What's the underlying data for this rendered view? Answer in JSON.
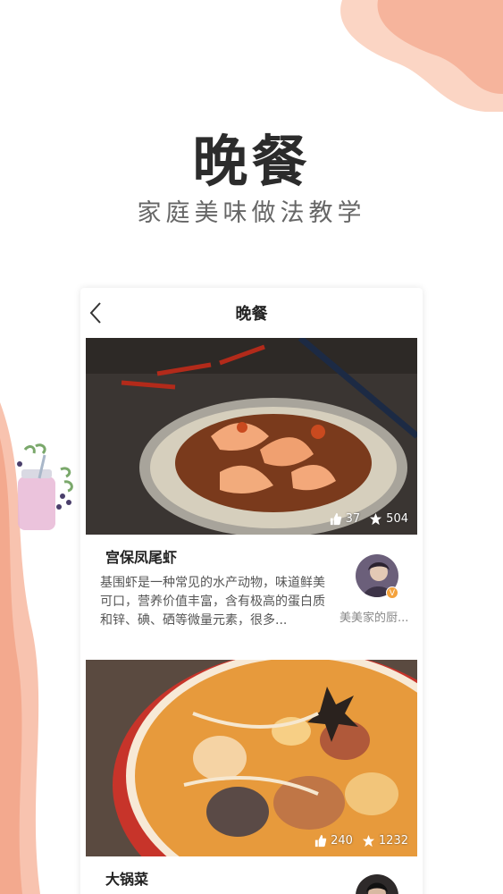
{
  "hero": {
    "title": "晚餐",
    "subtitle": "家庭美味做法教学"
  },
  "nav": {
    "title": "晚餐",
    "back_icon": "chevron-left-icon"
  },
  "recipes": [
    {
      "title": "宫保凤尾虾",
      "description": "基围虾是一种常见的水产动物，味道鲜美可口，营养价值丰富，含有极高的蛋白质和锌、碘、硒等微量元素，很多...",
      "likes": "37",
      "favorites": "504",
      "author": "美美家的厨..."
    },
    {
      "title": "大锅菜",
      "likes": "240",
      "favorites": "1232"
    }
  ],
  "colors": {
    "accent_peach": "#f6b49c",
    "accent_light": "#fbd5c4",
    "vip_badge": "#f4a23c"
  }
}
